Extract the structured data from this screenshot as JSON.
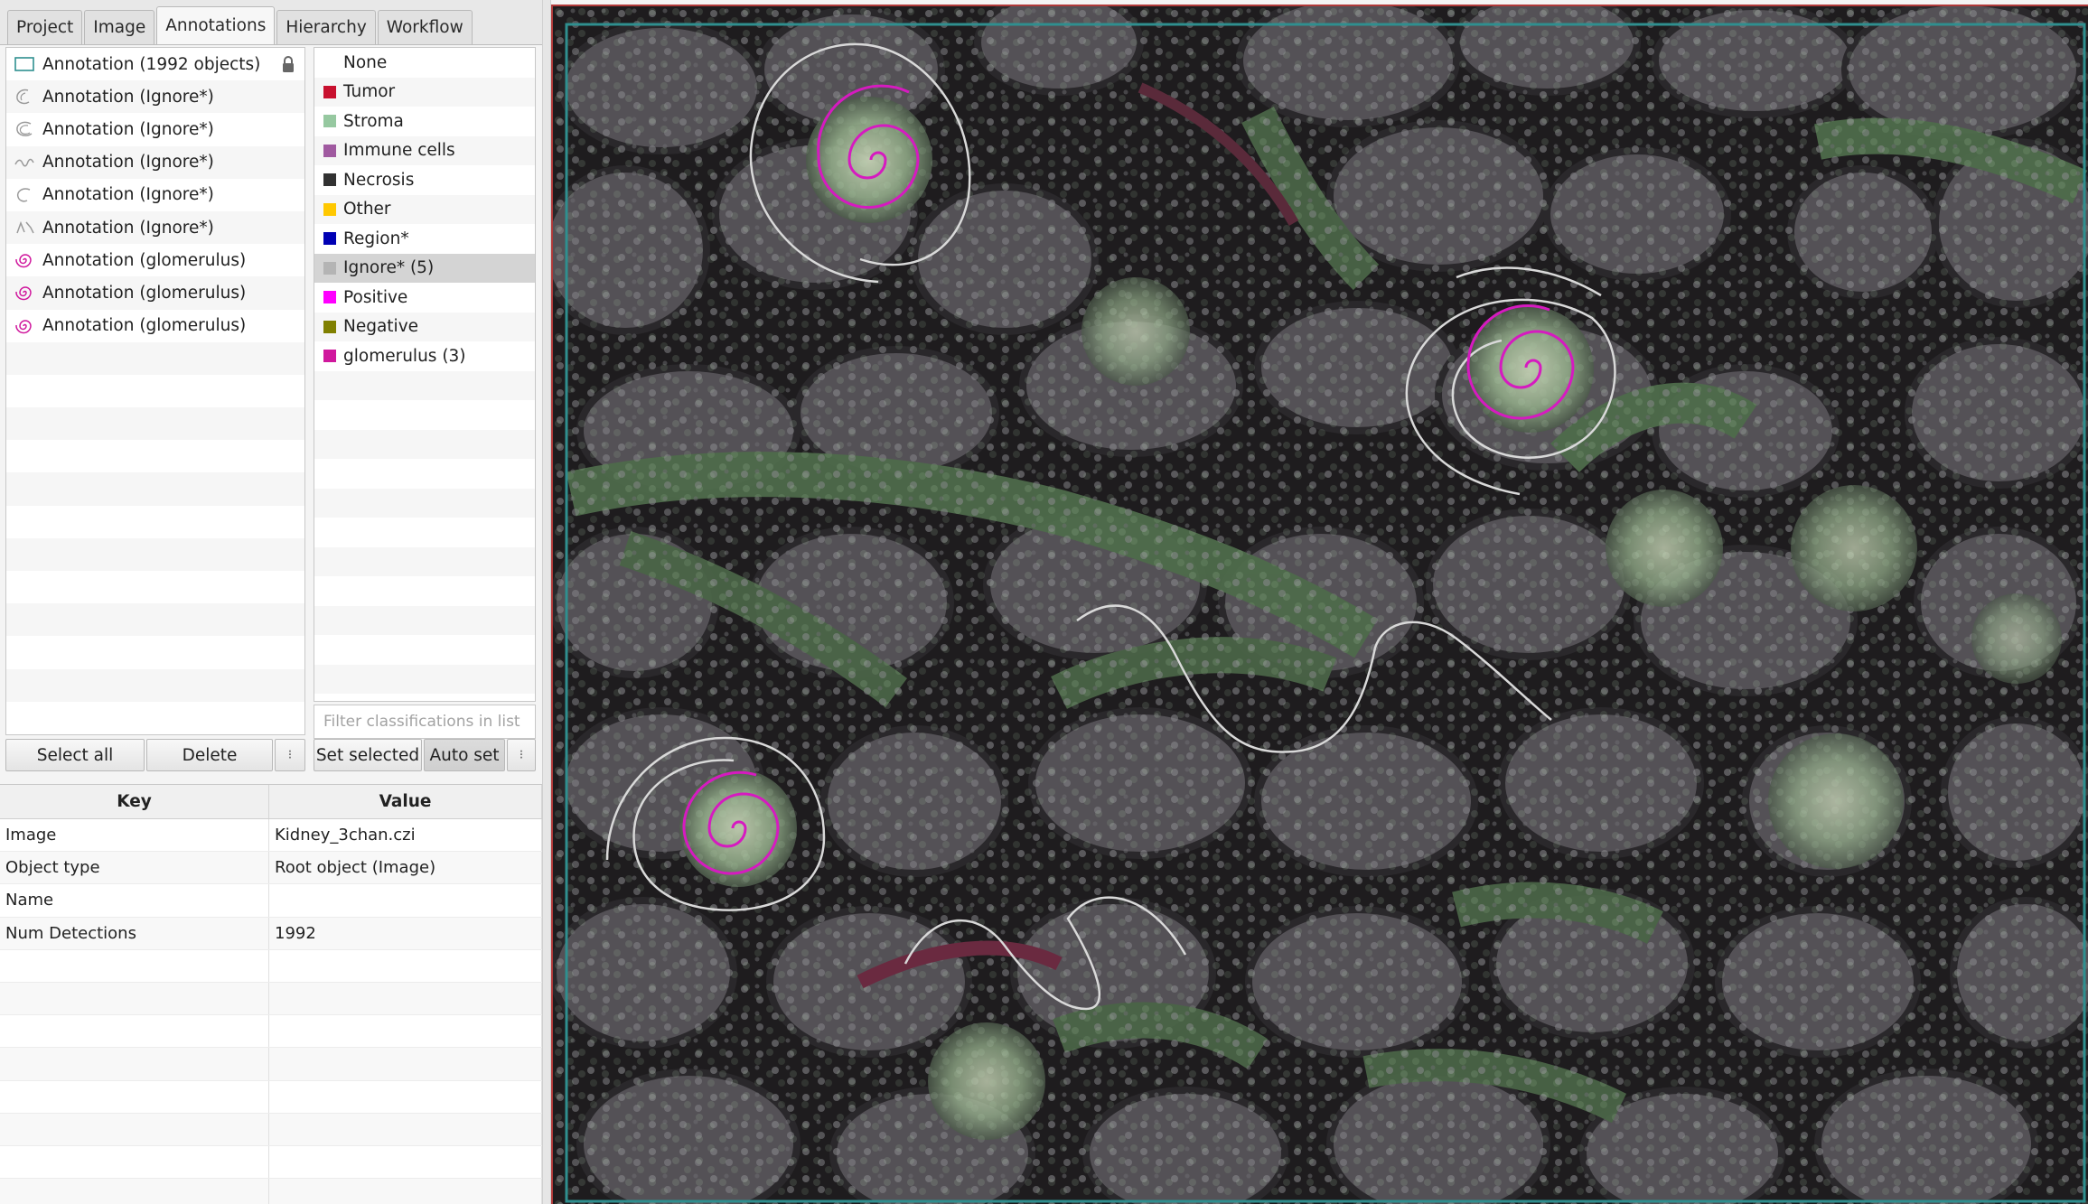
{
  "tabs": [
    {
      "label": "Project",
      "active": false
    },
    {
      "label": "Image",
      "active": false
    },
    {
      "label": "Annotations",
      "active": true
    },
    {
      "label": "Hierarchy",
      "active": false
    },
    {
      "label": "Workflow",
      "active": false
    }
  ],
  "annotations": [
    {
      "label": "Annotation (1992 objects)",
      "icon": "rectangle-icon",
      "color": "#2f8f8f",
      "locked": true
    },
    {
      "label": "Annotation (Ignore*)",
      "icon": "ellipse-outline-icon",
      "color": "#9a9a9a"
    },
    {
      "label": "Annotation (Ignore*)",
      "icon": "ellipse-outline-icon",
      "color": "#9a9a9a"
    },
    {
      "label": "Annotation (Ignore*)",
      "icon": "polyline-icon",
      "color": "#9a9a9a"
    },
    {
      "label": "Annotation (Ignore*)",
      "icon": "ellipse-outline-icon",
      "color": "#9a9a9a"
    },
    {
      "label": "Annotation (Ignore*)",
      "icon": "polyline-icon",
      "color": "#9a9a9a"
    },
    {
      "label": "Annotation (glomerulus)",
      "icon": "spiral-icon",
      "color": "#d0189d"
    },
    {
      "label": "Annotation (glomerulus)",
      "icon": "spiral-icon",
      "color": "#d0189d"
    },
    {
      "label": "Annotation (glomerulus)",
      "icon": "spiral-icon",
      "color": "#d0189d"
    }
  ],
  "annotation_buttons": {
    "select_all": "Select all",
    "delete": "Delete"
  },
  "classes": [
    {
      "label": "None",
      "color": ""
    },
    {
      "label": "Tumor",
      "color": "#c8102e"
    },
    {
      "label": "Stroma",
      "color": "#96c8a0"
    },
    {
      "label": "Immune cells",
      "color": "#a05aa0"
    },
    {
      "label": "Necrosis",
      "color": "#323232"
    },
    {
      "label": "Other",
      "color": "#ffc800"
    },
    {
      "label": "Region*",
      "color": "#0000b4"
    },
    {
      "label": "Ignore* (5)",
      "color": "#b4b4b4",
      "selected": true
    },
    {
      "label": "Positive",
      "color": "#ff00ff"
    },
    {
      "label": "Negative",
      "color": "#808000"
    },
    {
      "label": "glomerulus (3)",
      "color": "#d0189d"
    }
  ],
  "class_filter": {
    "placeholder": "Filter classifications in list"
  },
  "class_buttons": {
    "set_selected": "Set selected",
    "auto_set": "Auto set"
  },
  "properties": {
    "headers": {
      "key": "Key",
      "value": "Value"
    },
    "rows": [
      {
        "key": "Image",
        "value": "Kidney_3chan.czi"
      },
      {
        "key": "Object type",
        "value": "Root object (Image)"
      },
      {
        "key": "Name",
        "value": ""
      },
      {
        "key": "Num Detections",
        "value": "1992"
      }
    ]
  },
  "viewer_colors": {
    "selection_outline": "#2f8f8f",
    "ignore_annotation": "#d9d9d9",
    "glomerulus_annotation": "#d61ac0"
  }
}
